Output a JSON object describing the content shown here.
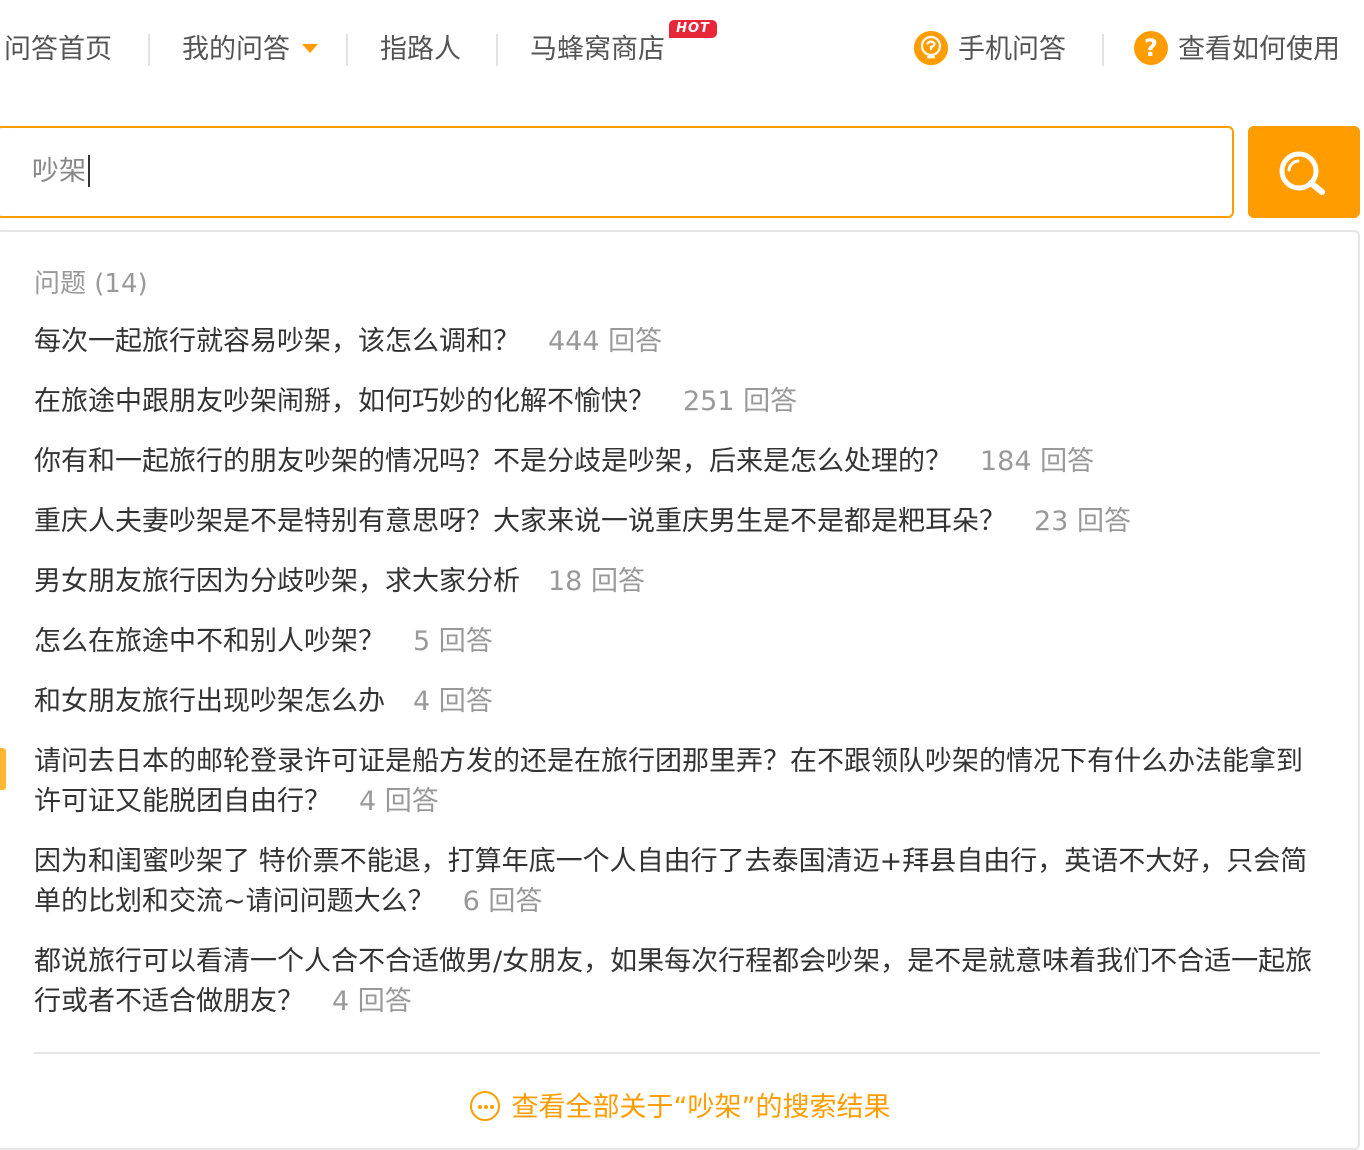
{
  "nav": {
    "items": [
      {
        "label": "问答首页"
      },
      {
        "label": "我的问答"
      },
      {
        "label": "指路人"
      },
      {
        "label": "马蜂窝商店"
      }
    ],
    "hot_badge": "HOT",
    "mobile_label": "手机问答",
    "help_label": "查看如何使用",
    "help_icon_glyph": "?"
  },
  "search": {
    "value": "吵架"
  },
  "results": {
    "section_title": "问题 (14)",
    "questions": [
      {
        "text": "每次一起旅行就容易吵架，该怎么调和？",
        "count": "444 回答"
      },
      {
        "text": "在旅途中跟朋友吵架闹掰，如何巧妙的化解不愉快？",
        "count": "251 回答"
      },
      {
        "text": "你有和一起旅行的朋友吵架的情况吗？不是分歧是吵架，后来是怎么处理的？",
        "count": "184 回答"
      },
      {
        "text": "重庆人夫妻吵架是不是特别有意思呀？大家来说一说重庆男生是不是都是粑耳朵？",
        "count": "23 回答"
      },
      {
        "text": "男女朋友旅行因为分歧吵架，求大家分析",
        "count": "18 回答"
      },
      {
        "text": "怎么在旅途中不和别人吵架？",
        "count": "5 回答"
      },
      {
        "text": "和女朋友旅行出现吵架怎么办",
        "count": "4 回答"
      },
      {
        "text": "请问去日本的邮轮登录许可证是船方发的还是在旅行团那里弄？在不跟领队吵架的情况下有什么办法能拿到许可证又能脱团自由行？",
        "count": "4 回答"
      },
      {
        "text": "因为和闺蜜吵架了 特价票不能退，打算年底一个人自由行了去泰国清迈+拜县自由行，英语不大好，只会简单的比划和交流~请问问题大么？",
        "count": "6 回答"
      },
      {
        "text": "都说旅行可以看清一个人合不合适做男/女朋友，如果每次行程都会吵架，是不是就意味着我们不合适一起旅行或者不适合做朋友？",
        "count": "4 回答"
      }
    ],
    "view_all": "查看全部关于“吵架”的搜索结果"
  },
  "colors": {
    "accent": "#ff9d00",
    "hot": "#e8263a",
    "muted": "#999999",
    "text": "#333333"
  },
  "icons": {
    "mobile": "lightbulb-question-icon",
    "help": "question-circle-icon",
    "search": "magnifier-icon",
    "more": "ellipsis-circle-icon",
    "dropdown": "caret-down-icon"
  }
}
